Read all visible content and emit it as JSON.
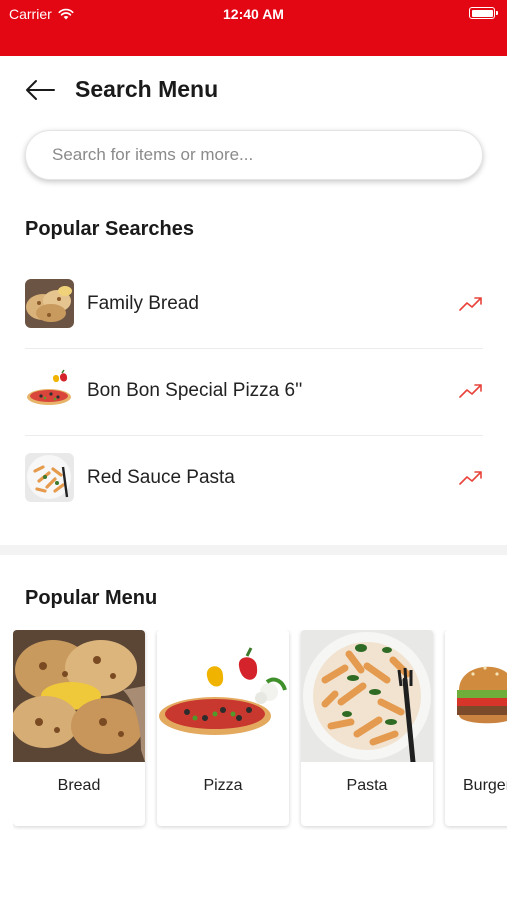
{
  "status_bar": {
    "carrier": "Carrier",
    "time": "12:40 AM",
    "color": "#e30613"
  },
  "header": {
    "title": "Search Menu",
    "back_icon": "back-arrow-icon"
  },
  "search": {
    "placeholder": "Search for items or more...",
    "value": ""
  },
  "popular_searches": {
    "title": "Popular Searches",
    "items": [
      {
        "label": "Family Bread",
        "thumb": "bread"
      },
      {
        "label": "Bon Bon Special Pizza 6''",
        "thumb": "pizza"
      },
      {
        "label": "Red Sauce Pasta",
        "thumb": "pasta"
      }
    ],
    "trend_icon": "trending-up-icon",
    "trend_color": "#e8433b"
  },
  "popular_menu": {
    "title": "Popular Menu",
    "items": [
      {
        "label": "Bread"
      },
      {
        "label": "Pizza"
      },
      {
        "label": "Pasta"
      },
      {
        "label": "Burger St"
      }
    ]
  }
}
